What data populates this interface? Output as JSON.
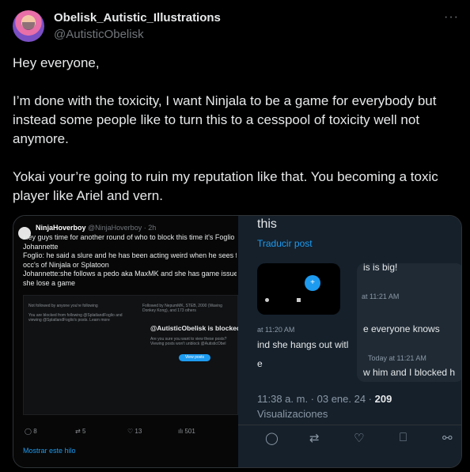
{
  "author": {
    "display_name": "Obelisk_Autistic_Illustrations",
    "handle": "@AutisticObelisk"
  },
  "more_label": "···",
  "post": {
    "paragraphs": [
      "Hey everyone,",
      "I’m done with the toxicity, I want Ninjala to be a game for everybody but instead some people like to turn this to a cesspool of toxicity well not anymore.",
      "Yokai your’re going to ruin my reputation like that. You becoming a toxic player like Ariel and vern."
    ]
  },
  "left_shot": {
    "name": "NinjaHoverboy",
    "meta": "@NinjaHoverboy · 2h",
    "lines": [
      "Hey guys time for another round of who to block this time it's Foglio an",
      "Johannette",
      "Foglio: he said a slure and he has been acting weird when he sees fem",
      "occ's of Ninjala or Splatoon",
      "Johannette:she follows a pedo aka MaxMK and she has game issues w",
      "she lose a game"
    ],
    "inner": {
      "not_followed": "Not followed by anyone you're following",
      "blocked_note": "You are blocked from following @SplatlandFoglio and viewing @SplatlandFoglio's posts. Learn more",
      "followed_by": "Followed by NepumMK, STEB, 2000 (Waving Donkey Kong), and 173 others",
      "blocked_title": "@AutisticObelisk is blocked",
      "blocked_sub": "Are you sure you want to view these posts? Viewing posts won't unblock @AutisticObel",
      "view_button": "View posts"
    },
    "actions": [
      "8",
      "5",
      "13",
      "501"
    ],
    "thread_link": "Mostrar este hilo"
  },
  "right_shot": {
    "top_word": "this",
    "translate": "Traducir post",
    "card_lines": [
      "is is big!",
      "e everyone knows",
      "w him and I blocked h"
    ],
    "card_times": [
      "at 11:21 AM",
      "Today at 11:21 AM"
    ],
    "left_lines": [
      "ind she hangs out witl",
      "e"
    ],
    "left_time": "at 11:20 AM",
    "timestamp": "11:38 a. m. · 03 ene. 24 ·",
    "views_count": "209",
    "views_label": "Visualizaciones"
  },
  "icons": [
    "reply-icon",
    "repost-icon",
    "like-icon",
    "bookmark-icon",
    "share-icon"
  ]
}
